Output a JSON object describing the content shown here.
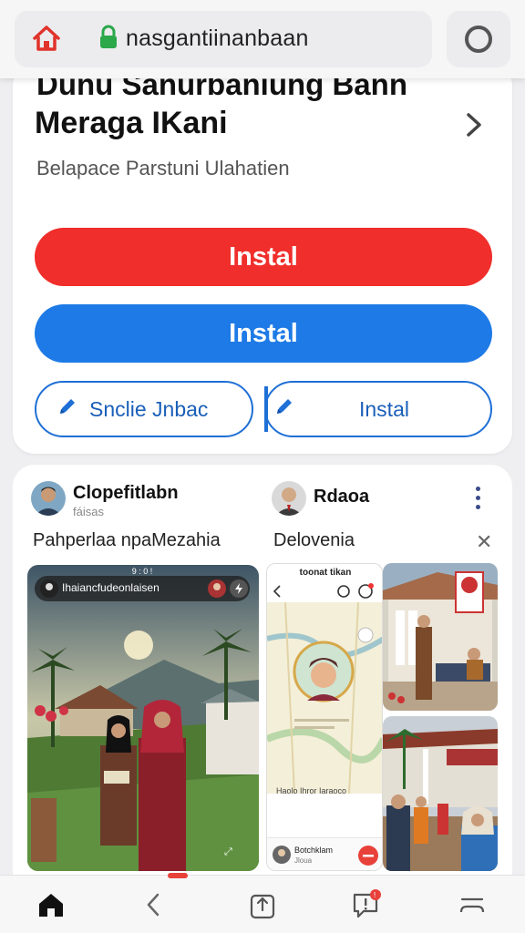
{
  "browser": {
    "url": "nasgantiinanbaan",
    "accent": "#1e7ae6"
  },
  "card": {
    "cut_title": "Dunu Sanurbaniung Bann",
    "title": "Meraga IKani",
    "subtitle": "Belapace Parstuni Ulahatien",
    "buttons": {
      "install_red": "Instal",
      "install_blue": "Instal",
      "outline_left": "Snclie Jnbac",
      "outline_right": "Instal"
    },
    "colors": {
      "red": "#f02e2b",
      "blue": "#1e7ae6"
    }
  },
  "feed": {
    "post_left": {
      "name": "Clopefitlabn",
      "handle": "fáisas",
      "desc": "Pahperlaa  npaMezahia",
      "overlay_title": "Ihaiancfudeonlaisen",
      "overlay_top": "9 : 0 !"
    },
    "post_right": {
      "name": "Rdaoa",
      "desc": "Delovenia",
      "phone_header": "toonat tikan",
      "phone_caption": "Haolo Ihror Iaraoco",
      "phone_footer_name": "Botchklam",
      "phone_footer_sub": "Jloua"
    }
  },
  "nav": {
    "badge_color": "#e8413a",
    "items": [
      "home-icon",
      "back-icon",
      "share-icon",
      "notifications-icon",
      "menu-icon"
    ]
  }
}
